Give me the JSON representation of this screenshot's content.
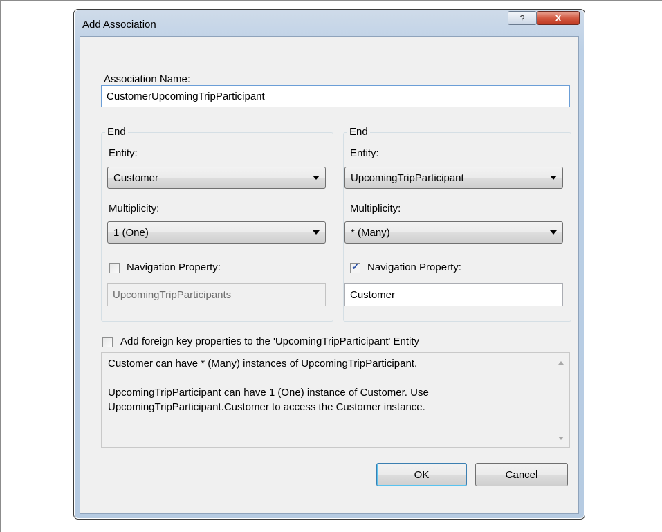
{
  "window": {
    "title": "Add Association",
    "help_glyph": "?",
    "close_glyph": "X"
  },
  "association_name": {
    "label": "Association Name:",
    "value": "CustomerUpcomingTripParticipant"
  },
  "end1": {
    "group_label": "End",
    "entity_label": "Entity:",
    "entity_value": "Customer",
    "multiplicity_label": "Multiplicity:",
    "multiplicity_value": "1 (One)",
    "nav_label": "Navigation Property:",
    "nav_checked": false,
    "nav_value": "UpcomingTripParticipants"
  },
  "end2": {
    "group_label": "End",
    "entity_label": "Entity:",
    "entity_value": "UpcomingTripParticipant",
    "multiplicity_label": "Multiplicity:",
    "multiplicity_value": "* (Many)",
    "nav_label": "Navigation Property:",
    "nav_checked": true,
    "nav_value": "Customer"
  },
  "foreign_key": {
    "label": "Add foreign key properties to the 'UpcomingTripParticipant' Entity",
    "checked": false
  },
  "description": {
    "line1": "Customer can have * (Many) instances of UpcomingTripParticipant.",
    "line2": "UpcomingTripParticipant can have 1 (One) instance of Customer. Use",
    "line3": "UpcomingTripParticipant.Customer to access the Customer instance."
  },
  "buttons": {
    "ok": "OK",
    "cancel": "Cancel"
  },
  "icons": {
    "help": "help-icon",
    "close": "close-icon",
    "dropdown": "chevron-down-icon",
    "check": "checkmark-icon"
  }
}
